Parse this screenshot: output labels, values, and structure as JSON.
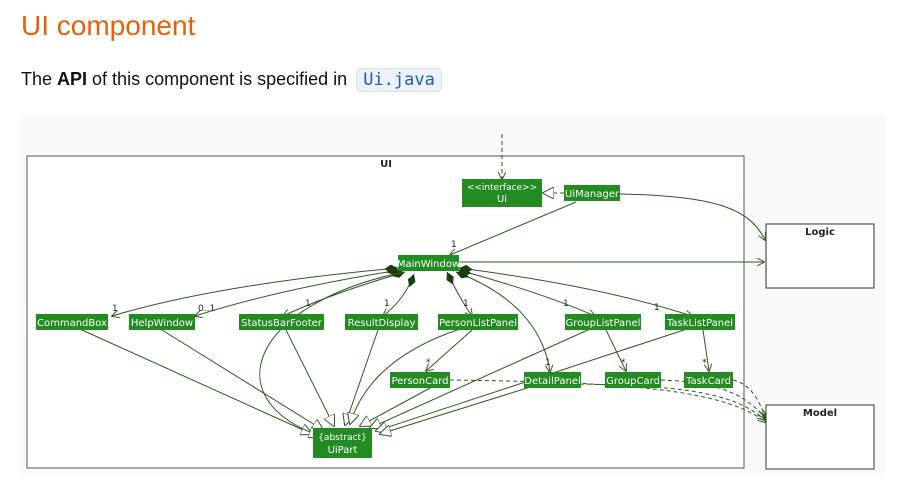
{
  "heading": "UI component",
  "intro": {
    "pre": "The ",
    "api": "API",
    "mid": " of this component is specified in",
    "code": "Ui.java"
  },
  "diagram": {
    "package_label": "UI",
    "interface_stereotype": "<<interface>>",
    "interface_name": "Ui",
    "ui_manager": "UiManager",
    "main_window": "MainWindow",
    "logic": "Logic",
    "model": "Model",
    "command_box": "CommandBox",
    "help_window": "HelpWindow",
    "status_bar_footer": "StatusBarFooter",
    "result_display": "ResultDisplay",
    "person_list_panel": "PersonListPanel",
    "group_list_panel": "GroupListPanel",
    "task_list_panel": "TaskListPanel",
    "person_card": "PersonCard",
    "detail_panel": "DetailPanel",
    "group_card": "GroupCard",
    "task_card": "TaskCard",
    "ui_part_stereotype": "{abstract}",
    "ui_part_name": "UiPart",
    "mult": {
      "one": "1",
      "zero_one": "0..1",
      "many": "*"
    },
    "colors": {
      "box": "#228b22",
      "line": "#2e5a1c",
      "heading": "#e36209"
    }
  }
}
